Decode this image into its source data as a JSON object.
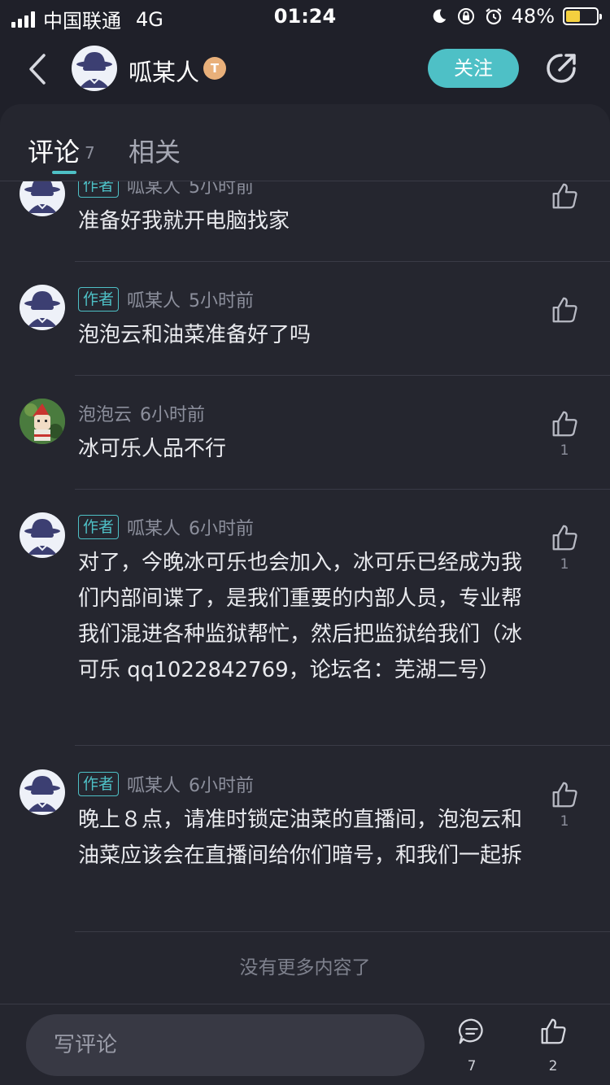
{
  "status_bar": {
    "carrier": "中国联通",
    "network": "4G",
    "time": "01:24",
    "battery": "48%",
    "battery_level": 0.48,
    "battery_color": "#f4d03f"
  },
  "nav": {
    "username": "呱某人",
    "badge": "T",
    "follow_label": "关注",
    "accent": "#4ec0c6"
  },
  "tabs": {
    "comments_label": "评论",
    "comments_count": "7",
    "related_label": "相关"
  },
  "comments": [
    {
      "author_tag": "作者",
      "name": "呱某人",
      "time": "5小时前",
      "text": "准备好我就开电脑找家",
      "likes": ""
    },
    {
      "author_tag": "作者",
      "name": "呱某人",
      "time": "5小时前",
      "text": "泡泡云和油菜准备好了吗",
      "likes": ""
    },
    {
      "author_tag": "",
      "name": "泡泡云",
      "time": "6小时前",
      "text": "冰可乐人品不行",
      "likes": "1"
    },
    {
      "author_tag": "作者",
      "name": "呱某人",
      "time": "6小时前",
      "text": "对了，今晚冰可乐也会加入，冰可乐已经成为我们内部间谍了，是我们重要的内部人员，专业帮我们混进各种监狱帮忙，然后把监狱给我们（冰可乐 qq1022842769，论坛名：芜湖二号）",
      "likes": "1"
    },
    {
      "author_tag": "作者",
      "name": "呱某人",
      "time": "6小时前",
      "text": "晚上８点，请准时锁定油菜的直播间，泡泡云和油菜应该会在直播间给你们暗号，和我们一起拆",
      "likes": "1"
    }
  ],
  "no_more_text": "没有更多内容了",
  "bottom_bar": {
    "write_placeholder": "写评论",
    "comment_count": "7",
    "like_count": "2"
  }
}
